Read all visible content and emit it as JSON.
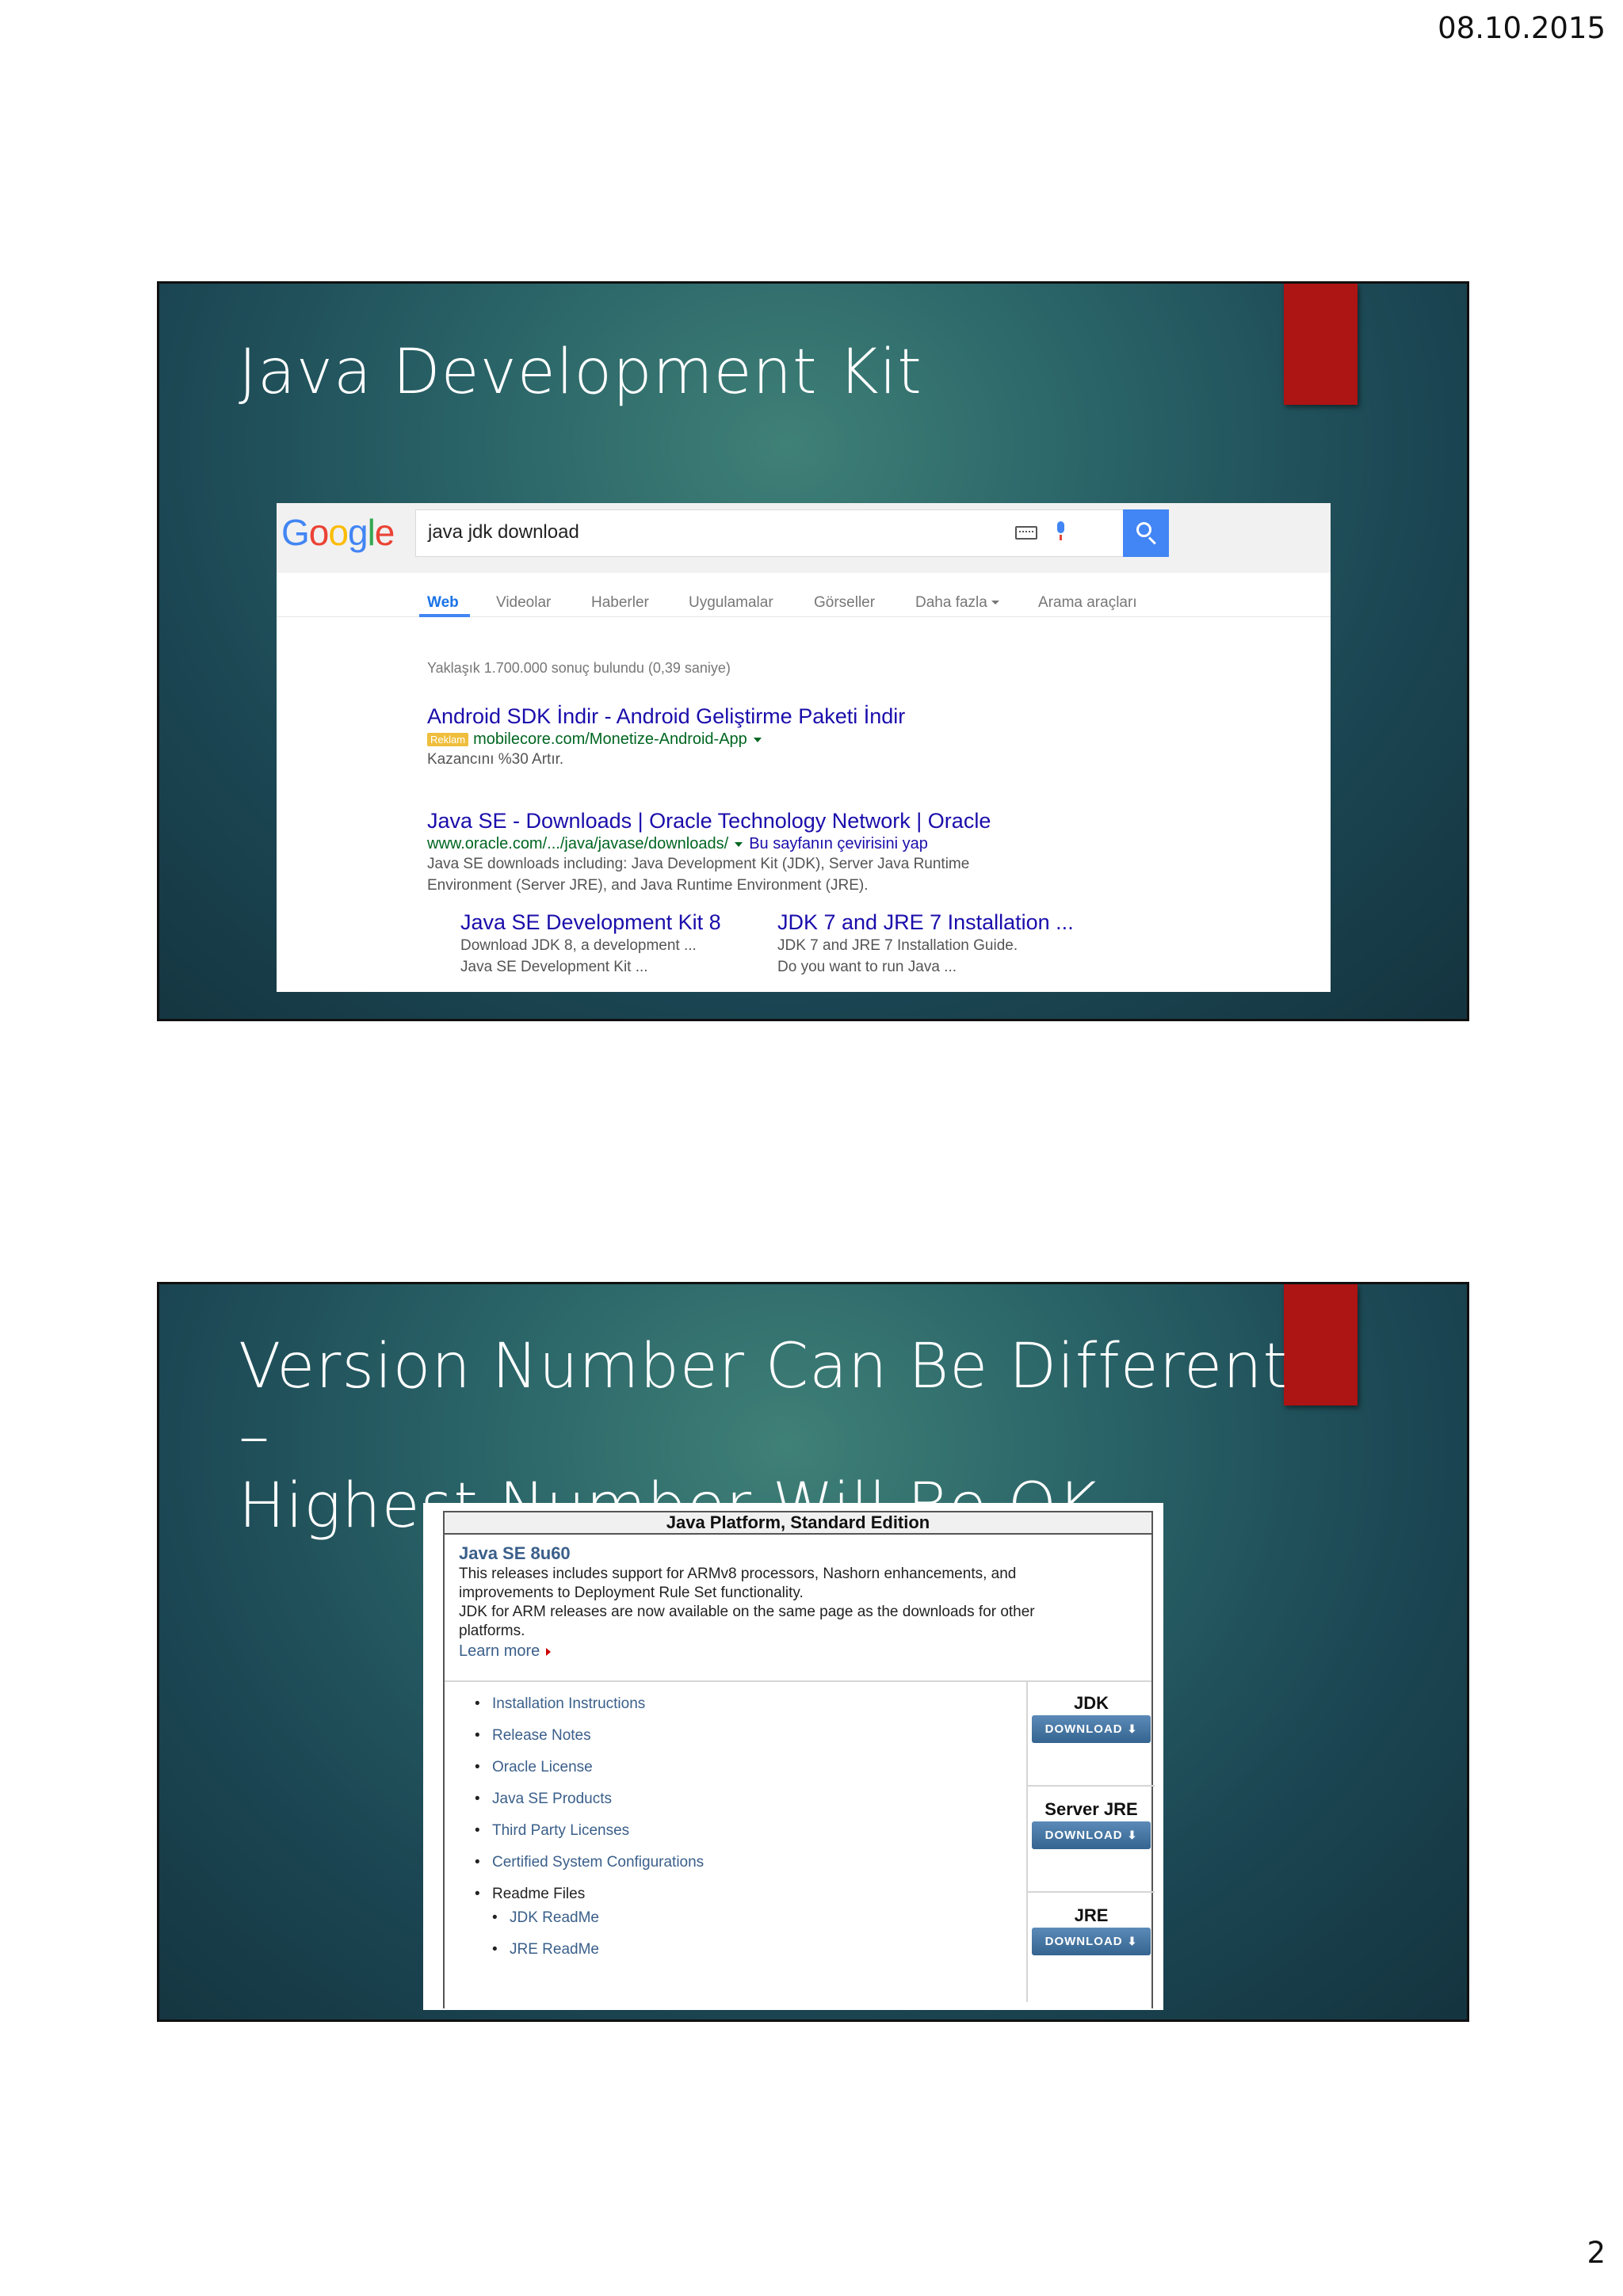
{
  "page": {
    "date": "08.10.2015",
    "number": "2"
  },
  "slide1": {
    "title": "Java Development Kit",
    "google": {
      "logo": [
        "G",
        "o",
        "o",
        "g",
        "l",
        "e"
      ],
      "query": "java jdk download",
      "tabs": [
        "Web",
        "Videolar",
        "Haberler",
        "Uygulamalar",
        "Görseller",
        "Daha fazla",
        "Arama araçları"
      ],
      "stats": "Yaklaşık 1.700.000 sonuç bulundu (0,39 saniye)",
      "ad": {
        "title": "Android SDK İndir - Android Geliştirme Paketi İndir",
        "badge": "Reklam",
        "url": "mobilecore.com/Monetize-Android-App",
        "snippet": "Kazancını %30 Artır."
      },
      "result": {
        "title": "Java SE - Downloads | Oracle Technology Network | Oracle",
        "url": "www.oracle.com/.../java/javase/downloads/",
        "translate": "Bu sayfanın çevirisini yap",
        "snippet1": "Java SE downloads including: Java Development Kit (JDK), Server Java Runtime",
        "snippet2": "Environment (Server JRE), and Java Runtime Environment (JRE).",
        "sitelinks": [
          {
            "title": "Java SE Development Kit 8",
            "line1": "Download JDK 8, a development ...",
            "line2": "Java SE Development Kit ..."
          },
          {
            "title": "JDK 7 and JRE 7 Installation ...",
            "line1": "JDK 7 and JRE 7 Installation Guide.",
            "line2": "Do you want to run Java ..."
          }
        ]
      }
    }
  },
  "slide2": {
    "title_line1": "Version Number Can Be Different –",
    "title_line2": "Highest Number Will Be OK",
    "oracle": {
      "header": "Java Platform, Standard Edition",
      "release": "Java SE 8u60",
      "desc1": "This releases includes support for ARMv8 processors, Nashorn enhancements, and",
      "desc2": "improvements to Deployment Rule Set functionality.",
      "desc3": "JDK for ARM releases are now available on the same page as the downloads for other",
      "desc4": "platforms.",
      "learn_more": "Learn more",
      "links": [
        "Installation Instructions",
        "Release Notes",
        "Oracle License",
        "Java SE Products",
        "Third Party Licenses",
        "Certified System Configurations"
      ],
      "readme": "Readme Files",
      "readme_links": [
        "JDK ReadMe",
        "JRE ReadMe"
      ],
      "downloads": [
        {
          "label": "JDK",
          "button": "DOWNLOAD"
        },
        {
          "label": "Server JRE",
          "button": "DOWNLOAD"
        },
        {
          "label": "JRE",
          "button": "DOWNLOAD"
        }
      ]
    }
  }
}
